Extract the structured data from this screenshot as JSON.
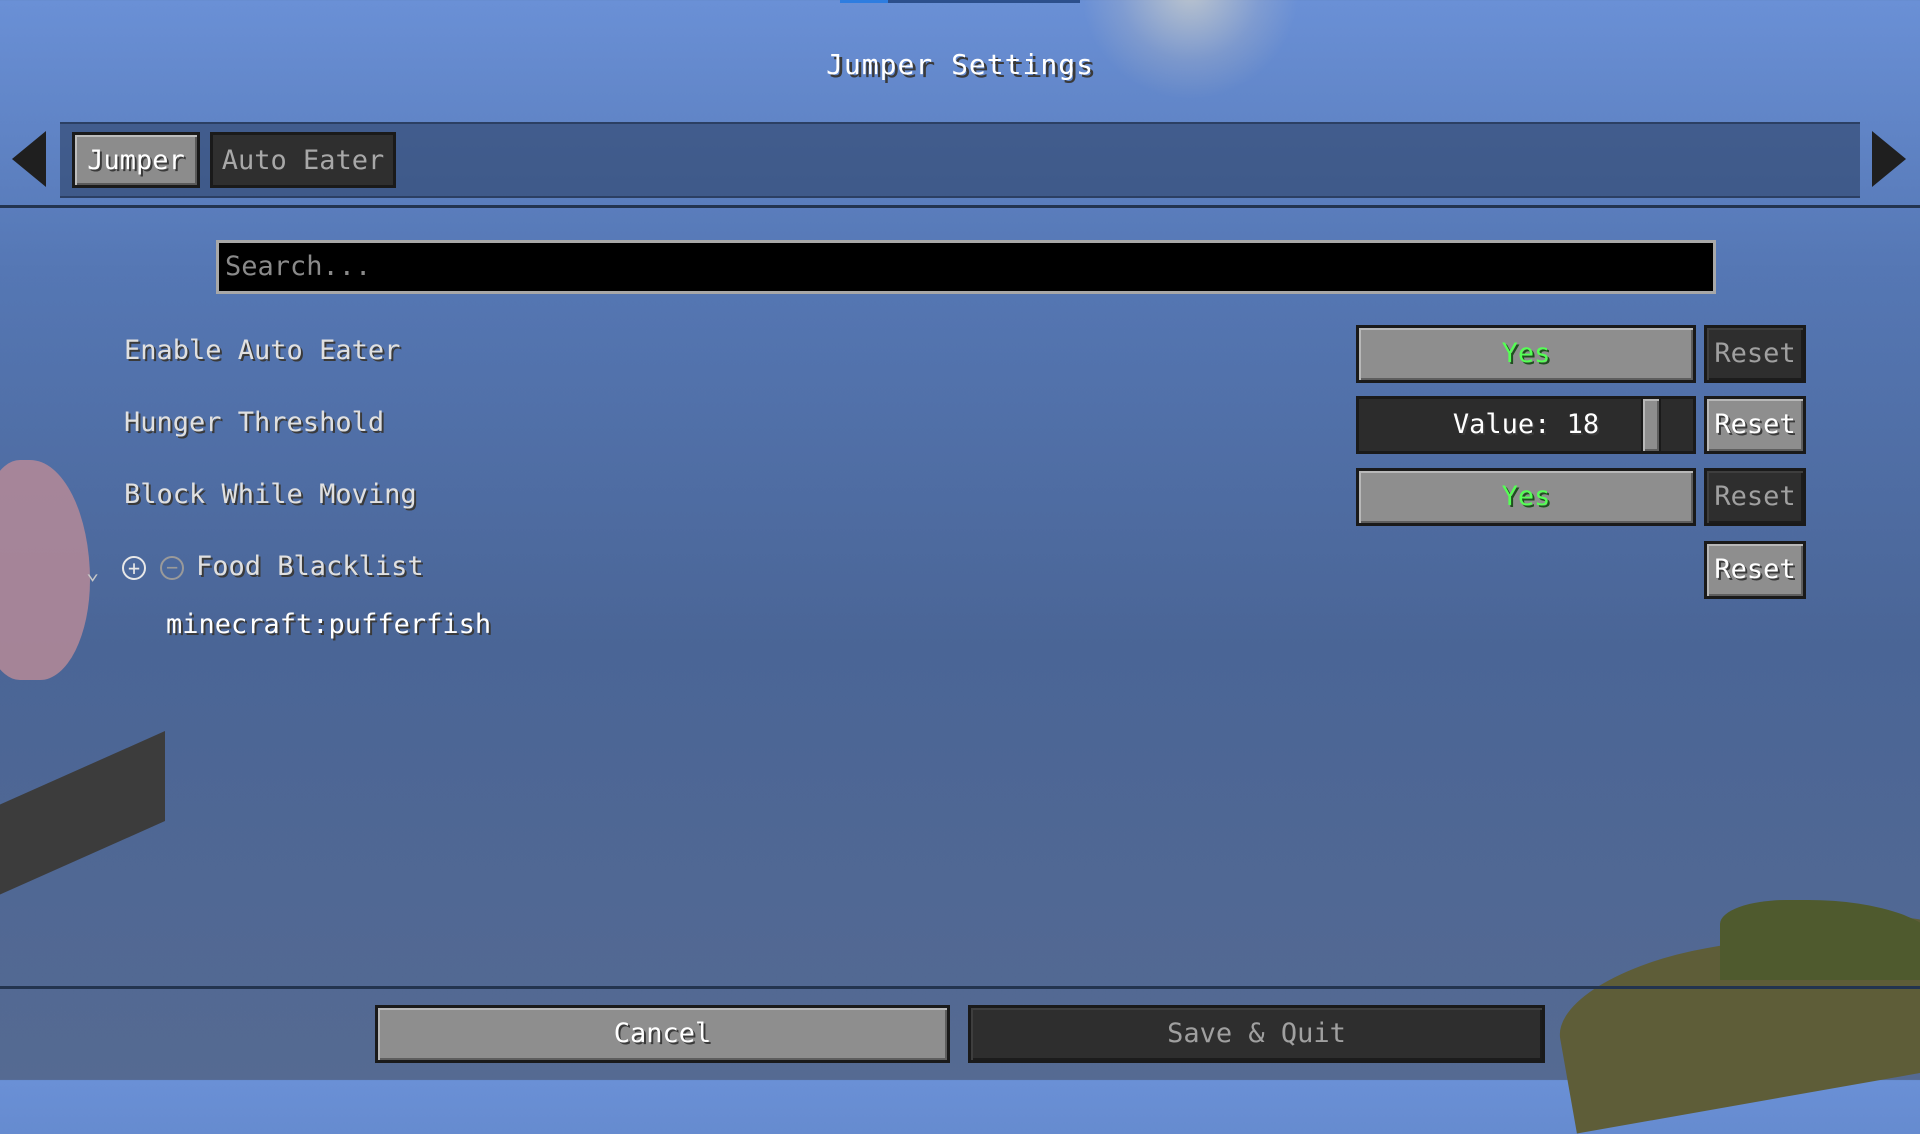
{
  "window": {
    "title": "Jumper Settings"
  },
  "tabs": [
    {
      "label": "Jumper",
      "active": true
    },
    {
      "label": "Auto Eater",
      "active": false
    }
  ],
  "search": {
    "placeholder": "Search..."
  },
  "settings": {
    "enable_auto_eater": {
      "label": "Enable Auto Eater",
      "value": "Yes",
      "reset": "Reset"
    },
    "hunger_threshold": {
      "label": "Hunger Threshold",
      "value": "Value: 18",
      "reset": "Reset"
    },
    "block_while_moving": {
      "label": "Block While Moving",
      "value": "Yes",
      "reset": "Reset"
    },
    "food_blacklist": {
      "label": "Food Blacklist",
      "reset": "Reset",
      "entries": [
        "minecraft:pufferfish"
      ]
    }
  },
  "footer": {
    "cancel": "Cancel",
    "save": "Save & Quit"
  },
  "icons": {
    "nav_left": "arrow-left-icon",
    "nav_right": "arrow-right-icon",
    "expand": "chevron-down-icon",
    "add": "plus-circle-icon",
    "remove": "minus-circle-icon"
  },
  "colors": {
    "yes_text": "#55ff55",
    "search_bg": "#000000"
  }
}
